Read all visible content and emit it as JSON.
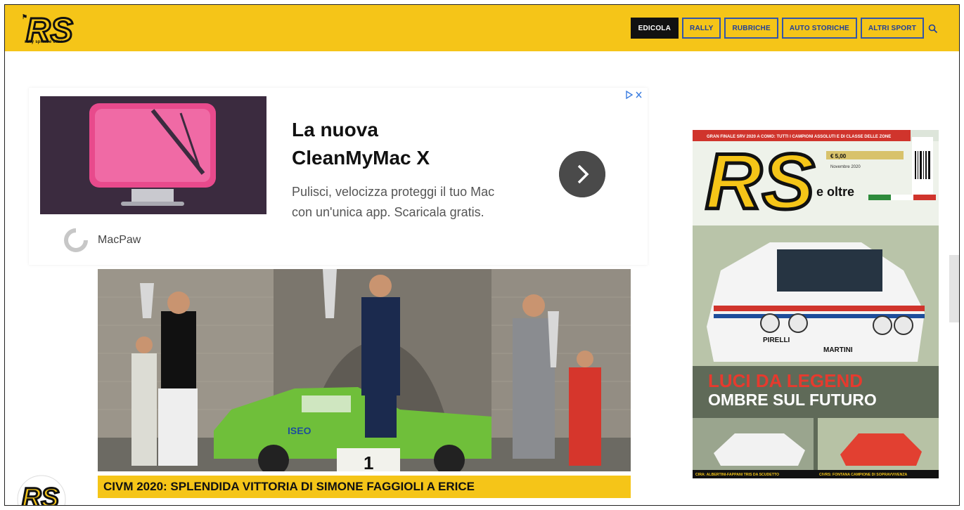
{
  "header": {
    "logo_text": "RS",
    "logo_tagline": "rally sprint e oltre",
    "nav": [
      {
        "label": "EDICOLA",
        "active": true
      },
      {
        "label": "RALLY",
        "active": false
      },
      {
        "label": "RUBRICHE",
        "active": false
      },
      {
        "label": "AUTO STORICHE",
        "active": false
      },
      {
        "label": "ALTRI SPORT",
        "active": false
      }
    ],
    "search_icon": "search-icon"
  },
  "ad": {
    "title_line1": "La nuova",
    "title_line2": "CleanMyMac X",
    "description": "Pulisci, velocizza proteggi il tuo Mac con un'unica app. Scaricala gratis.",
    "brand": "MacPaw",
    "cta_icon": "chevron-right-icon",
    "adchoices_icon": "adchoices-icon"
  },
  "hero": {
    "caption": "CIVM 2020: SPLENDIDA VITTORIA DI SIMONE FAGGIOLI A ERICE",
    "podium_number": "1",
    "car_sponsor": "ISEO"
  },
  "cover": {
    "strip_text": "GRAN FINALE SRV 2020 A COMO: TUTTI I CAMPIONI ASSOLUTI E DI CLASSE DELLE ZONE",
    "logo_text": "RS",
    "logo_suffix": "e oltre",
    "price": "€ 5,00",
    "issue": "Novembre 2020",
    "headline1": "LUCI DA LEGEND",
    "headline2": "OMBRE SUL FUTURO",
    "sub_left": "CIRA: ALBERTINI-FAPPANI TRIS DA SCUDETTO",
    "sub_right": "CIVRS: FONTANA CAMPIONE DI SOPRAVVIVENZA",
    "car_sponsor": "MARTINI",
    "tyre_brand": "PIRELLI"
  },
  "colors": {
    "brand_yellow": "#f5c518",
    "nav_blue": "#1f3f9b",
    "caption_yellow": "#f5c518"
  }
}
